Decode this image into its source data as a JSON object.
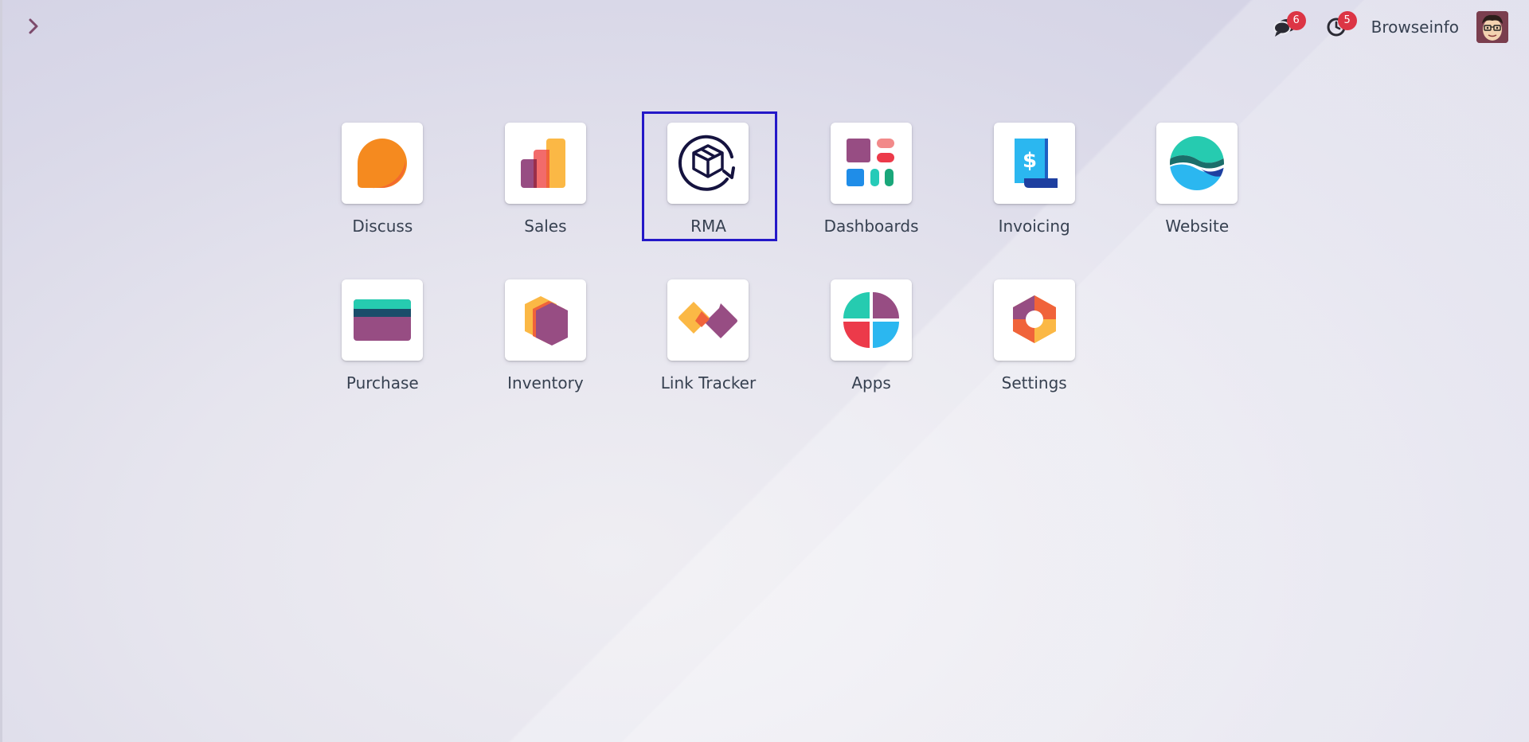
{
  "systray": {
    "messages_count": "6",
    "activities_count": "5",
    "username": "Browseinfo"
  },
  "apps": [
    {
      "label": "Discuss",
      "icon": "discuss-icon"
    },
    {
      "label": "Sales",
      "icon": "sales-icon"
    },
    {
      "label": "RMA",
      "icon": "rma-icon",
      "selected": true
    },
    {
      "label": "Dashboards",
      "icon": "dashboards-icon"
    },
    {
      "label": "Invoicing",
      "icon": "invoicing-icon"
    },
    {
      "label": "Website",
      "icon": "website-icon"
    },
    {
      "label": "Purchase",
      "icon": "purchase-icon"
    },
    {
      "label": "Inventory",
      "icon": "inventory-icon"
    },
    {
      "label": "Link Tracker",
      "icon": "link-tracker-icon"
    },
    {
      "label": "Apps",
      "icon": "apps-icon"
    },
    {
      "label": "Settings",
      "icon": "settings-icon"
    }
  ],
  "colors": {
    "selection": "#2418c8",
    "badge": "#dc3545",
    "toggle": "#7c4a6b"
  }
}
